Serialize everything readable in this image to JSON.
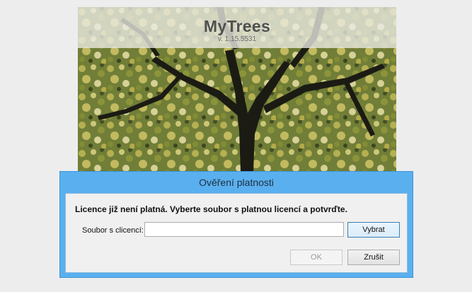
{
  "splash": {
    "app_name": "MyTrees",
    "version": "v. 1.15.5531"
  },
  "dialog": {
    "title": "Ověření platnosti",
    "message": "Licence již není platná. Vyberte soubor s platnou licencí a potvrďte.",
    "file_label": "Soubor s clicencí:",
    "file_value": "",
    "select_button": "Vybrat",
    "ok_button": "OK",
    "cancel_button": "Zrušit",
    "colors": {
      "frame": "#5ab0ef",
      "body": "#f0f0f0"
    }
  }
}
